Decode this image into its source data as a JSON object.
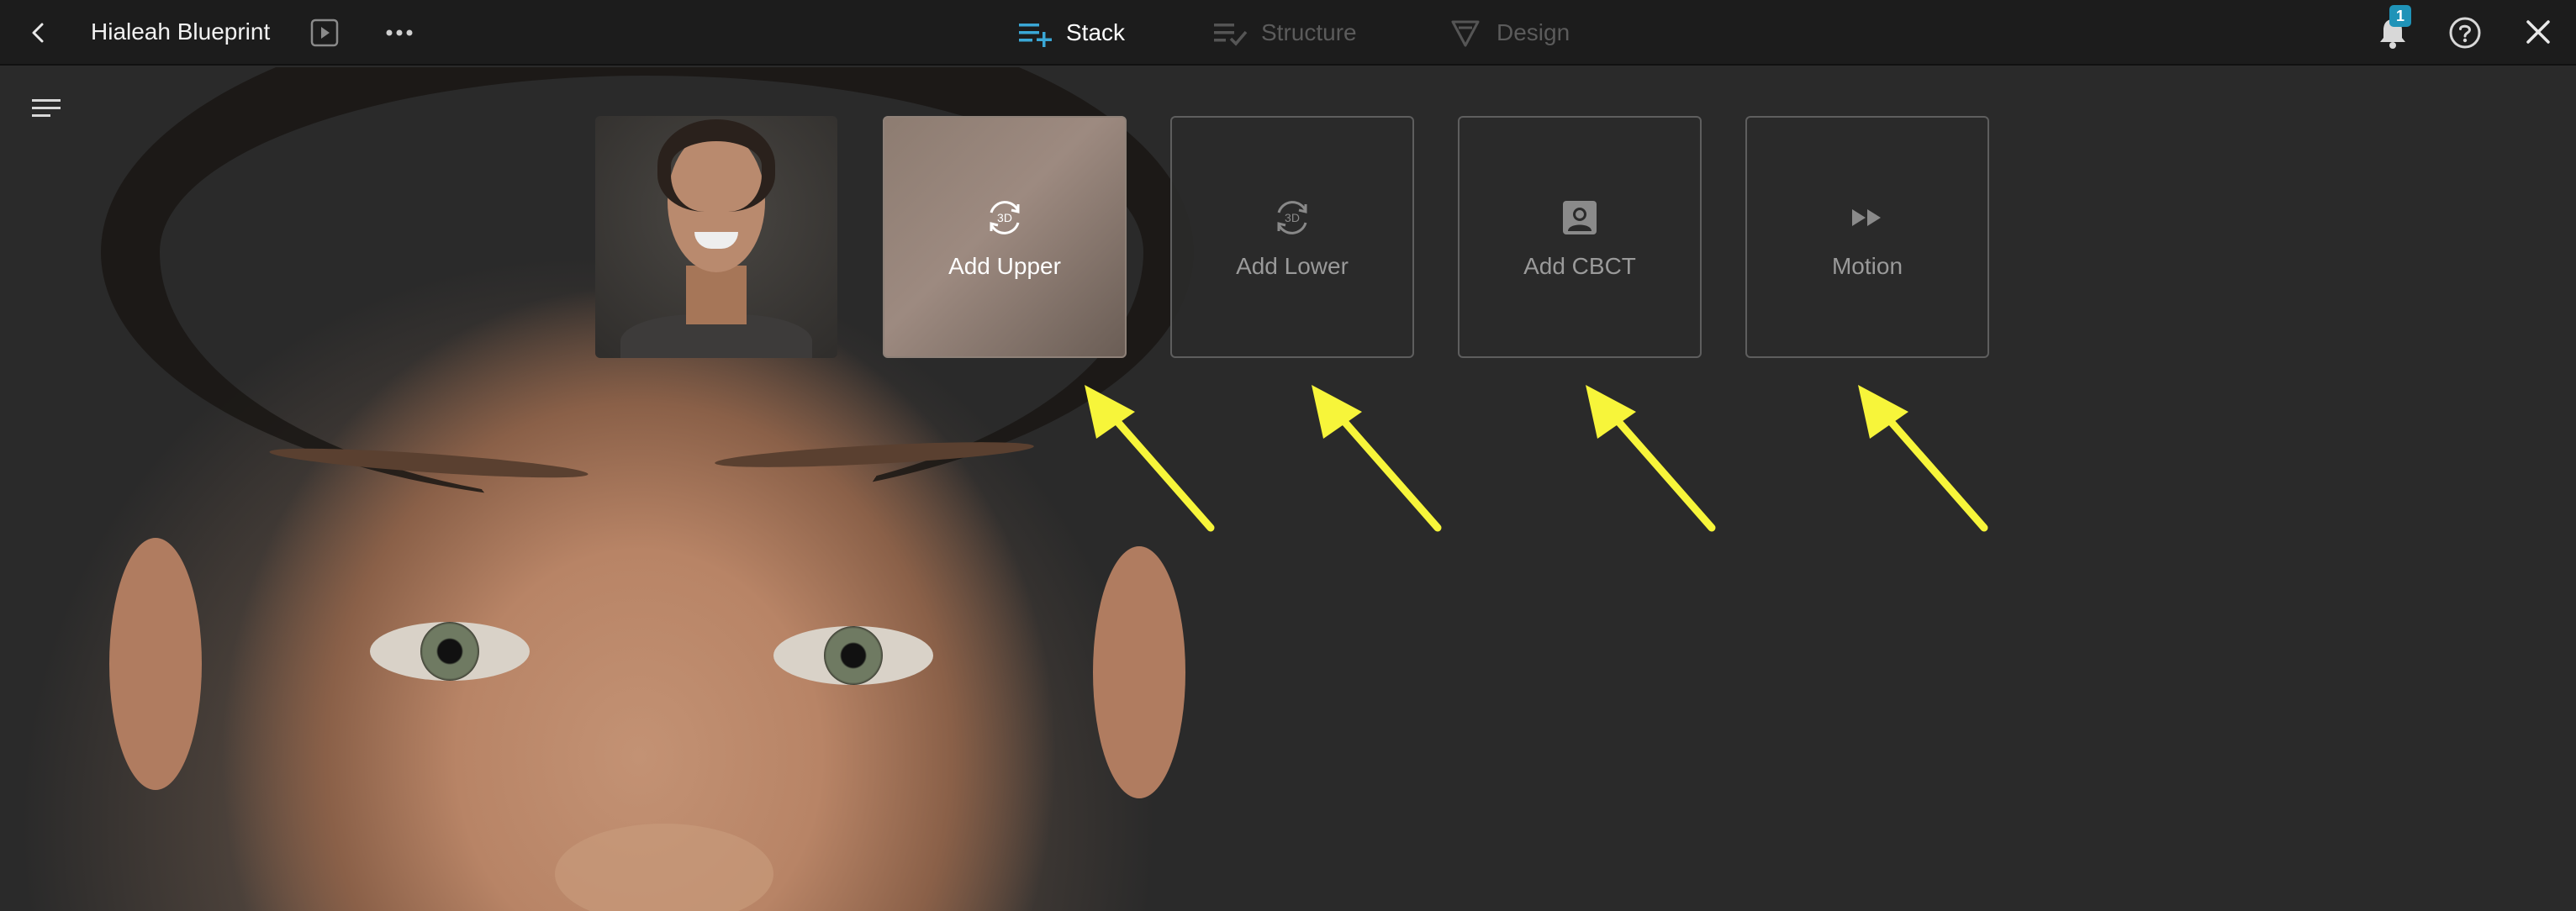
{
  "topbar": {
    "title": "Hialeah Blueprint",
    "tabs": [
      {
        "label": "Stack",
        "active": true
      },
      {
        "label": "Structure",
        "active": false
      },
      {
        "label": "Design",
        "active": false
      }
    ],
    "notifications_count": "1"
  },
  "cards": {
    "add_upper": "Add Upper",
    "add_lower": "Add Lower",
    "add_cbct": "Add CBCT",
    "motion": "Motion",
    "icon_3d_text": "3D"
  },
  "colors": {
    "accent": "#1f93b8",
    "annotation_arrow": "#f7f53a",
    "background": "#2a2a2a",
    "topbar": "#1c1c1c"
  }
}
